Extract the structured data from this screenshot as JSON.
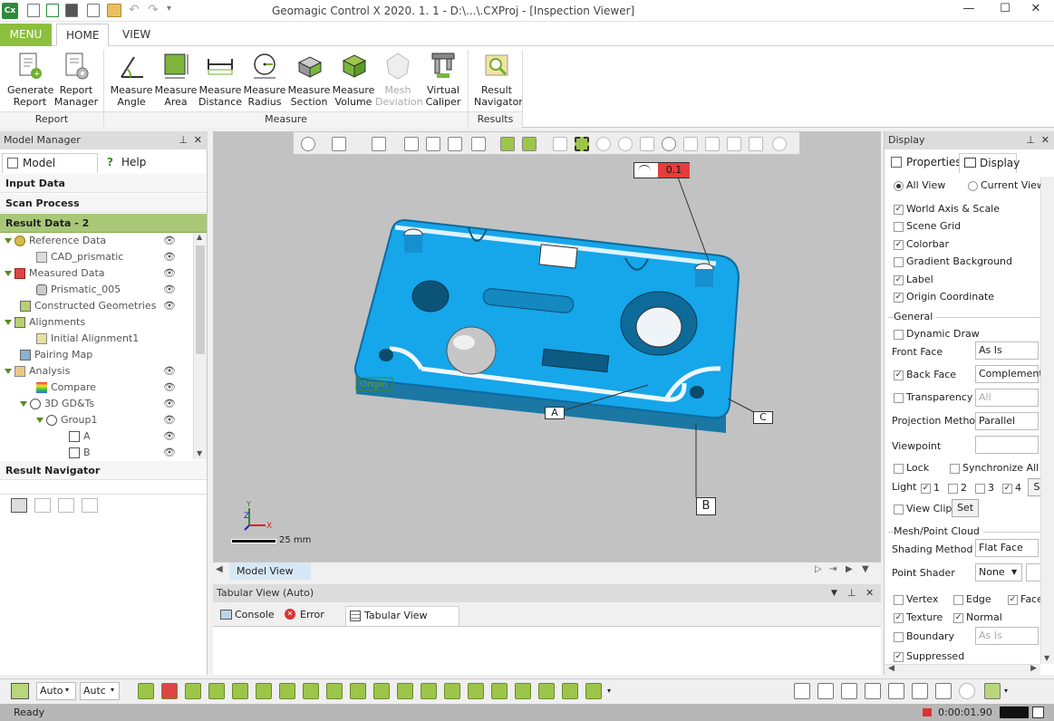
{
  "titlebar": {
    "app_logo": "Cx",
    "title": "Geomagic Control X 2020. 1. 1 - D:\\...\\.CXProj - [Inspection Viewer]"
  },
  "ribbon_tabs": [
    "MENU",
    "HOME",
    "VIEW"
  ],
  "ribbon": {
    "report_group": "Report",
    "measure_group": "Measure",
    "results_group": "Results",
    "generate_report": "Generate Report",
    "report_manager": "Report Manager",
    "measure_angle": "Measure Angle",
    "measure_area": "Measure Area",
    "measure_distance": "Measure Distance",
    "measure_radius": "Measure Radius",
    "measure_section": "Measure Section",
    "measure_volume": "Measure Volume",
    "mesh_deviation": "Mesh Deviation",
    "virtual_caliper": "Virtual Caliper",
    "result_navigator": "Result Navigator"
  },
  "model_manager": {
    "header": "Model Manager",
    "tab_model_manager": "Model Manager",
    "tab_help": "Help",
    "input_data": "Input Data",
    "scan_process": "Scan Process",
    "result_data": "Result Data - 2",
    "result_navigator": "Result Navigator",
    "tree": [
      {
        "label": "Reference Data"
      },
      {
        "label": "CAD_prismatic"
      },
      {
        "label": "Measured Data"
      },
      {
        "label": "Prismatic_005"
      },
      {
        "label": "Constructed Geometries"
      },
      {
        "label": "Alignments"
      },
      {
        "label": "Initial Alignment1"
      },
      {
        "label": "Pairing Map"
      },
      {
        "label": "Analysis"
      },
      {
        "label": "Compare"
      },
      {
        "label": "3D GD&Ts"
      },
      {
        "label": "Group1"
      },
      {
        "label": "A"
      },
      {
        "label": "B"
      }
    ]
  },
  "viewport": {
    "gdt_value": "0.1",
    "datum_a": "A",
    "datum_b": "B",
    "datum_c": "C",
    "origin_label": "Origin",
    "scale_label": "25 mm",
    "axis_x": "X",
    "axis_y": "Y",
    "axis_z": "Z",
    "bottom_tab": "Model View"
  },
  "tabular": {
    "header": "Tabular View (Auto)",
    "tab_console": "Console",
    "tab_error": "Error List",
    "tab_tabular": "Tabular View (Auto)"
  },
  "display": {
    "header": "Display",
    "tab_properties": "Properties",
    "tab_display": "Display",
    "all_view": "All View",
    "current_view": "Current View",
    "world_axis": "World Axis & Scale",
    "scene_grid": "Scene Grid",
    "colorbar": "Colorbar",
    "gradient_bg": "Gradient Background",
    "label": "Label",
    "origin_coord": "Origin Coordinate",
    "general": "General",
    "dynamic_draw": "Dynamic Draw",
    "front_face": "Front Face",
    "front_face_val": "As Is",
    "back_face": "Back Face",
    "back_face_val": "Complement",
    "transparency": "Transparency",
    "transparency_val": "All",
    "projection": "Projection Method",
    "projection_val": "Parallel",
    "viewpoint": "Viewpoint",
    "lock": "Lock",
    "sync": "Synchronize All Vi",
    "light": "Light",
    "light1": "1",
    "light2": "2",
    "light3": "3",
    "light4": "4",
    "light_btn": "S",
    "view_clip": "View Clip",
    "set": "Set",
    "mesh_point": "Mesh/Point Cloud",
    "shading": "Shading Method",
    "shading_val": "Flat Face",
    "point_shader": "Point Shader",
    "point_shader_val": "None",
    "vertex": "Vertex",
    "edge": "Edge",
    "face": "Face",
    "texture": "Texture",
    "normal": "Normal",
    "boundary": "Boundary",
    "boundary_val": "As Is",
    "suppressed": "Suppressed"
  },
  "bottom": {
    "auto1": "Auto",
    "auto2": "Autc"
  },
  "status": {
    "text": "Ready",
    "time": "0:00:01.90"
  }
}
